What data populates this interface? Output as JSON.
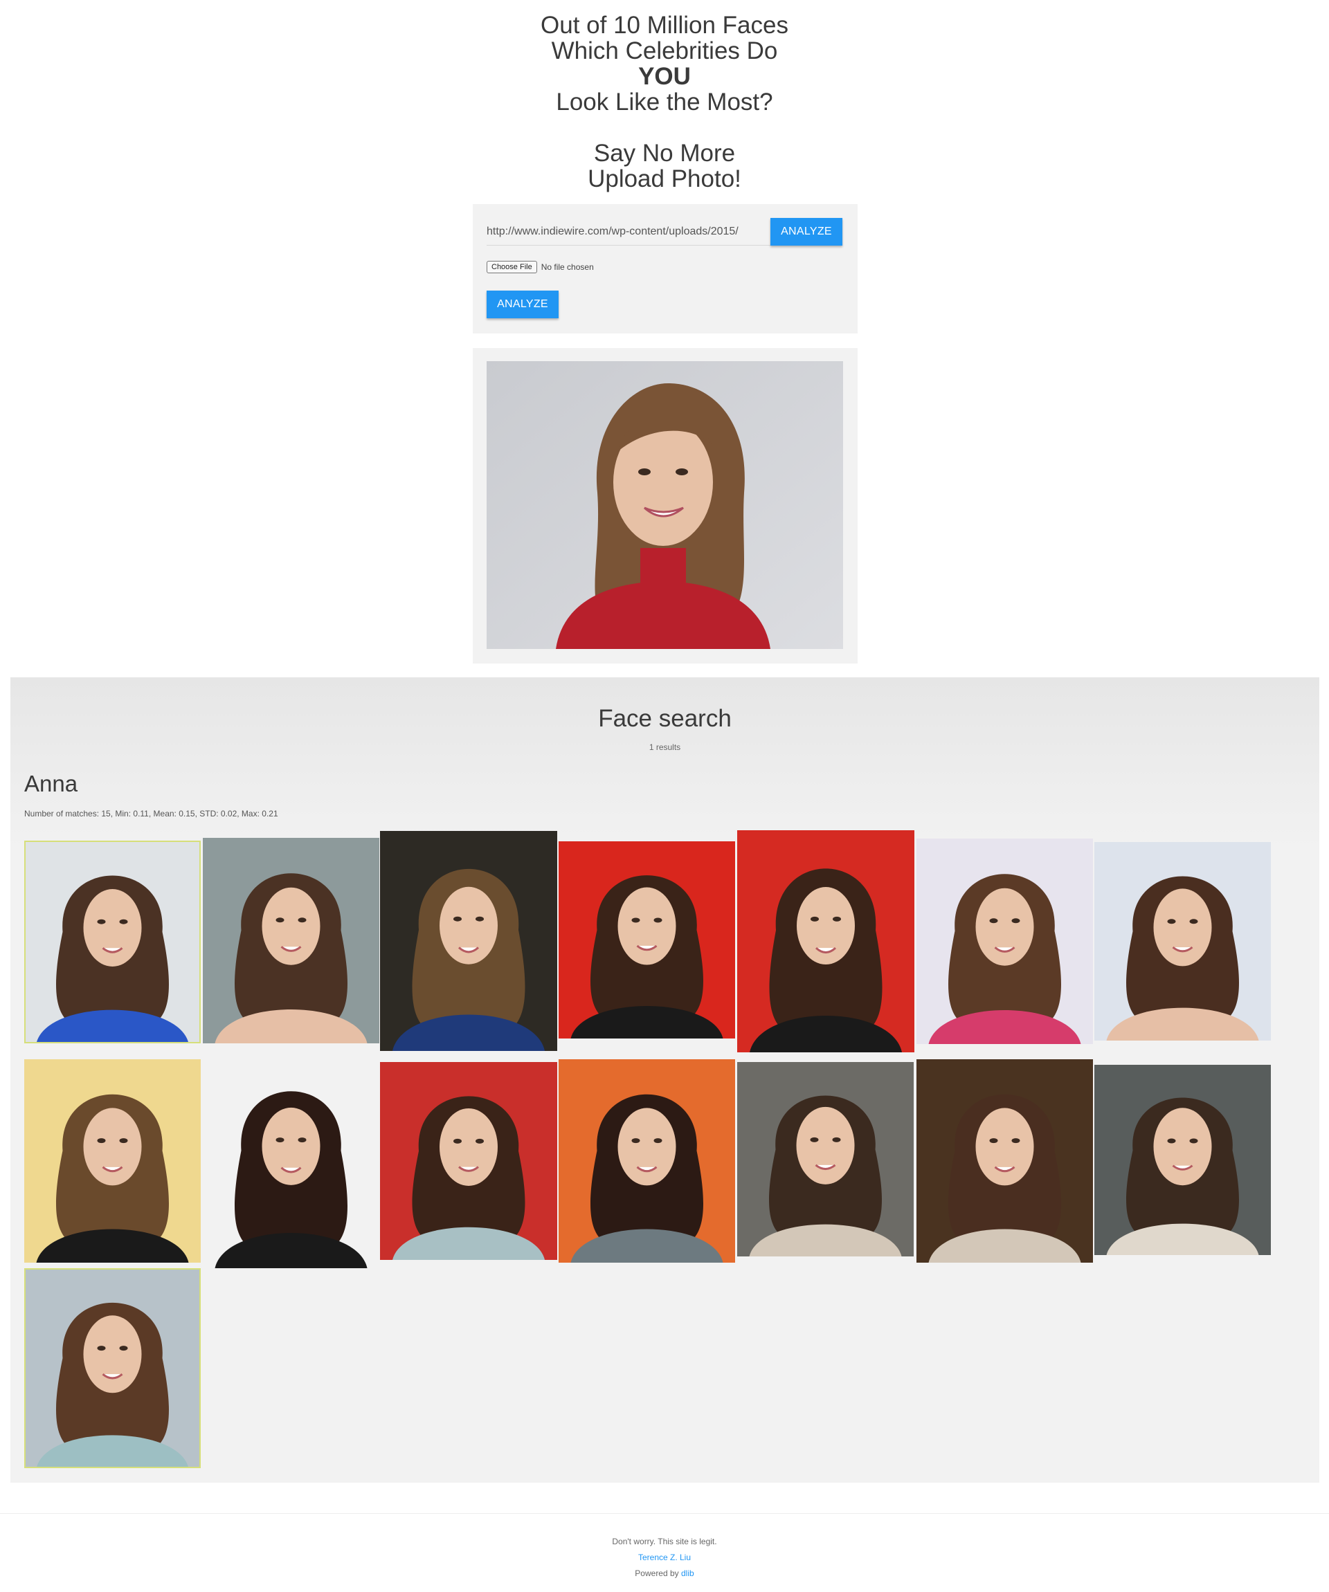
{
  "hero": {
    "line1": "Out of 10 Million Faces",
    "line2": "Which Celebrities Do",
    "line3": "YOU",
    "line4": "Look Like the Most?",
    "line5": "Say No More",
    "line6": "Upload Photo!"
  },
  "upload": {
    "url_value": "http://www.indiewire.com/wp-content/uploads/2015/",
    "analyze_url_label": "ANALYZE",
    "choose_file_label": "Choose File",
    "no_file_text": "No file chosen",
    "analyze_file_label": "ANALYZE"
  },
  "results": {
    "title": "Face search",
    "count": "1 results",
    "person": {
      "name": "Anna",
      "stats": "Number of matches: 15, Min: 0.11, Mean: 0.15, STD: 0.02, Max: 0.21"
    }
  },
  "footer": {
    "line1": "Don't worry. This site is legit.",
    "author": "Terence Z. Liu",
    "powered_prefix": "Powered by ",
    "powered_link": "dlib"
  },
  "colors": {
    "accent": "#2196f3",
    "selected_outline": "#d6df7a",
    "panel_bg": "#f2f2f2"
  }
}
